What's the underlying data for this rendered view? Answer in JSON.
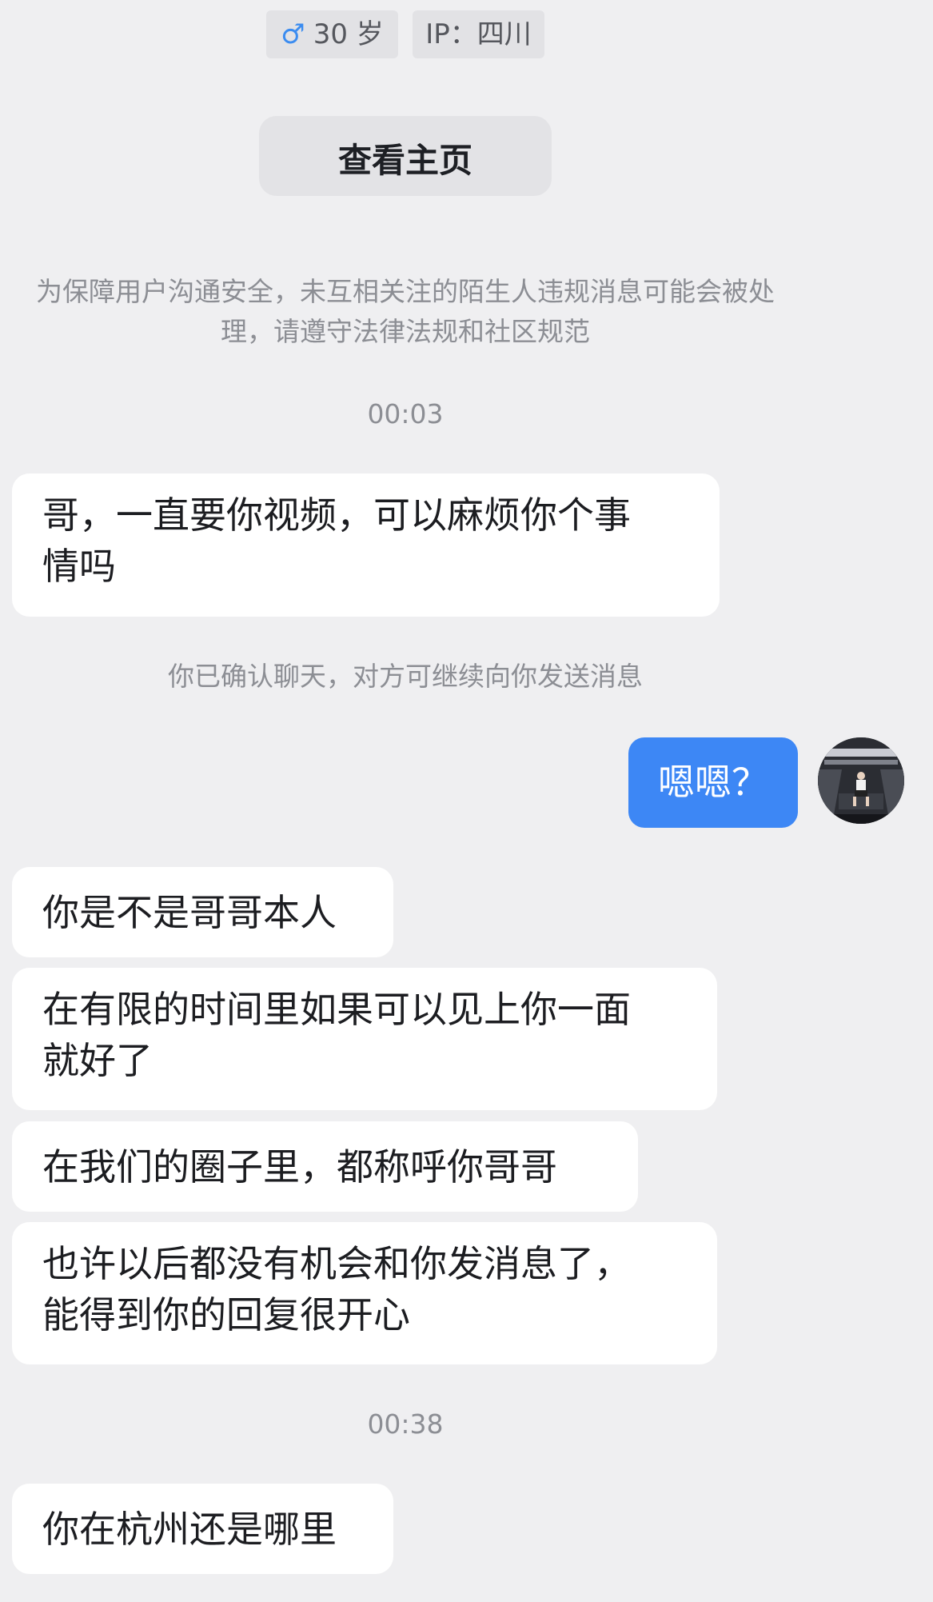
{
  "profile": {
    "gender_symbol": "♂",
    "age": "30 岁",
    "ip": "IP：四川",
    "view_profile_label": "查看主页"
  },
  "notice": {
    "line1": "为保障用户沟通安全，未互相关注的陌生人违规消息可能会被处",
    "line2": "理，请遵守法律法规和社区规范"
  },
  "timestamps": {
    "first": "00:03",
    "second": "00:38"
  },
  "system_message": "你已确认聊天，对方可继续向你发送消息",
  "messages": {
    "m1": "哥，一直要你视频，可以麻烦你个事\n情吗",
    "mine1": "嗯嗯？",
    "m2": "你是不是哥哥本人",
    "m3": "在有限的时间里如果可以见上你一面\n就好了",
    "m4": "在我们的圈子里，都称呼你哥哥",
    "m5": "也许以后都没有机会和你发消息了，\n能得到你的回复很开心",
    "m6": "你在杭州还是哪里"
  },
  "colors": {
    "background": "#efeff1",
    "bubble_incoming": "#ffffff",
    "bubble_outgoing": "#3d87f5",
    "gender_accent": "#3b8cf0",
    "muted_text": "#8c8e94"
  },
  "icons": {
    "avatar": "user-avatar-photo"
  }
}
